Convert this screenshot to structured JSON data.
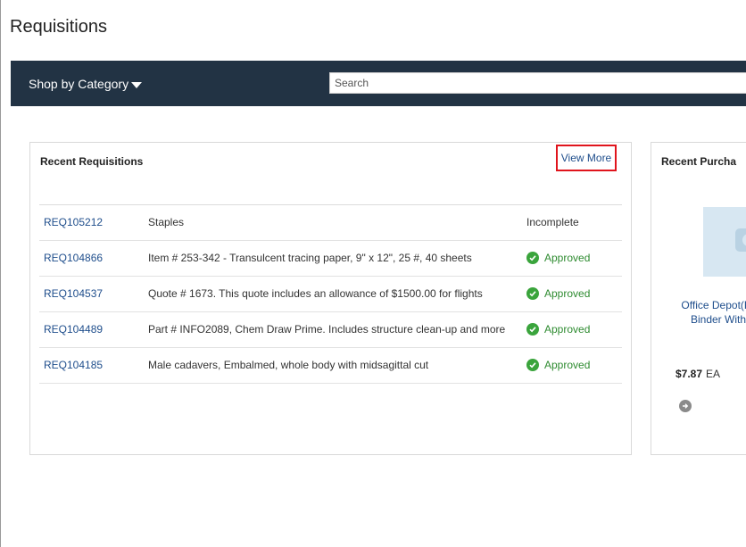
{
  "page": {
    "title": "Requisitions"
  },
  "navbar": {
    "shop_by_category": "Shop by Category",
    "search_placeholder": "Search"
  },
  "recent_requisitions": {
    "title": "Recent Requisitions",
    "view_more": "View More",
    "rows": [
      {
        "id": "REQ105212",
        "description": "Staples",
        "status": "Incomplete"
      },
      {
        "id": "REQ104866",
        "description": "Item # 253-342 - Transulcent tracing paper, 9\" x 12\", 25 #, 40 sheets",
        "status": "Approved"
      },
      {
        "id": "REQ104537",
        "description": "Quote # 1673. This quote includes an allowance of $1500.00 for flights",
        "status": "Approved"
      },
      {
        "id": "REQ104489",
        "description": "Part # INFO2089, Chem Draw Prime. Includes structure clean-up and more",
        "status": "Approved"
      },
      {
        "id": "REQ104185",
        "description": "Male cadavers, Embalmed, whole body with midsagittal cut",
        "status": "Approved"
      }
    ]
  },
  "recent_purchases": {
    "title": "Recent Purcha",
    "product_name_line1": "Office Depot(R)",
    "product_name_line2": "Binder With",
    "price": "$7.87",
    "uom": "EA",
    "image_icon": "camera-icon"
  },
  "colors": {
    "navbar_bg": "#223344",
    "link": "#1f4e8c",
    "approved": "#2e8b30",
    "highlight_box": "#e0141c"
  }
}
